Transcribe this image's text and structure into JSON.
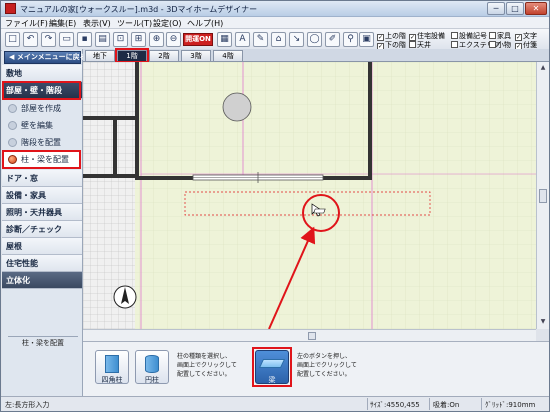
{
  "title": "マニュアルの家[ウォークスルー].m3d - 3Dマイホームデザイナー",
  "window_buttons": {
    "minimize": "─",
    "maximize": "□",
    "close": "✕"
  },
  "menu": [
    "ファイル(F)",
    "編集(E)",
    "表示(V)",
    "ツール(T)",
    "設定(O)",
    "ヘルプ(H)"
  ],
  "toolbar": {
    "help_label": "開運ON",
    "checkboxes": [
      {
        "label": "上の階",
        "checked": true
      },
      {
        "label": "住宅設備",
        "checked": true
      },
      {
        "label": "設備記号",
        "checked": false
      },
      {
        "label": "家具",
        "checked": false
      },
      {
        "label": "文字",
        "checked": true
      },
      {
        "label": "下の階",
        "checked": true
      },
      {
        "label": "天井",
        "checked": false
      },
      {
        "label": "エクステリア",
        "checked": false
      },
      {
        "label": "小物",
        "checked": false
      },
      {
        "label": "付箋",
        "checked": true
      }
    ]
  },
  "sidebar": {
    "main_menu_button": "メインメニューに戻る",
    "categories": [
      {
        "label": "敷地"
      },
      {
        "label": "部屋・壁・階段",
        "selected": true
      },
      {
        "label": "ドア・窓"
      },
      {
        "label": "設備・家具"
      },
      {
        "label": "照明・天井器具"
      },
      {
        "label": "診断／チェック"
      },
      {
        "label": "屋根"
      },
      {
        "label": "住宅性能"
      },
      {
        "label": "立体化"
      }
    ],
    "sub_items": [
      {
        "label": "部屋を作成"
      },
      {
        "label": "壁を編集"
      },
      {
        "label": "階段を配置"
      },
      {
        "label": "柱・梁を配置",
        "selected": true
      }
    ],
    "panel_label": "柱・梁を配置"
  },
  "floor_tabs": [
    "地下",
    "1階",
    "2階",
    "3階",
    "4階"
  ],
  "active_floor_tab": "1階",
  "bottom_panel": {
    "buttons": [
      {
        "label": "四角柱"
      },
      {
        "label": "円柱"
      },
      {
        "label": "梁"
      }
    ],
    "pillar_help": [
      "柱の種類を選択し、",
      "画面上でクリックして",
      "配置してください。"
    ],
    "beam_help": [
      "左のボタンを押し、",
      "画面上でクリックして",
      "配置してください。"
    ]
  },
  "status": {
    "mode": "左:長方形入力",
    "size": "ｻｲｽﾞ:4550,455",
    "snap": "吸着:On",
    "grid": "ｸﾞﾘｯﾄﾞ:910mm"
  },
  "colors": {
    "highlight": "#e0141a",
    "canvas": "#eef3d8",
    "accent": "#2c4d83"
  }
}
